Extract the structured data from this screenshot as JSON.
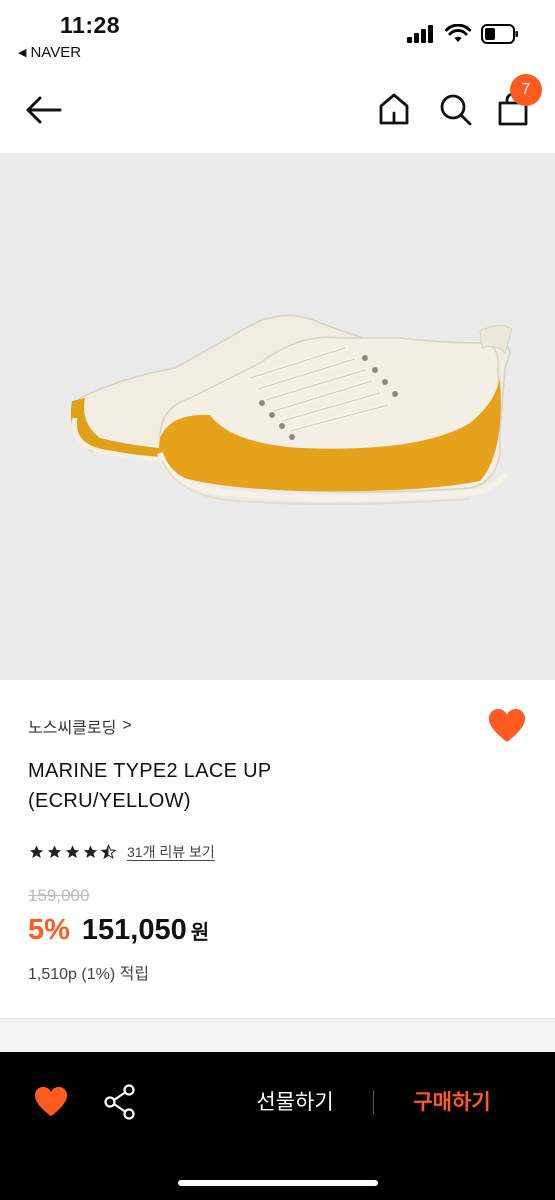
{
  "status_bar": {
    "time": "11:28",
    "back_app": "NAVER"
  },
  "header": {
    "cart_count": "7",
    "icons": [
      "back-arrow-icon",
      "home-icon",
      "search-icon",
      "cart-icon"
    ]
  },
  "product": {
    "brand": "노스씨클로딩",
    "brand_chevron": ">",
    "name_line1": "MARINE TYPE2 LACE UP",
    "name_line2": "(ECRU/YELLOW)",
    "rating_stars": 4.5,
    "review_link": "31개 리뷰 보기",
    "original_price": "159,000",
    "discount": "5%",
    "sale_price": "151,050",
    "currency": "원",
    "points": "1,510p (1%) 적립"
  },
  "bottom_bar": {
    "gift_label": "선물하기",
    "buy_label": "구매하기"
  },
  "colors": {
    "accent": "#ff5a1f",
    "image_bg": "#ebebeb",
    "bottom_bar_bg": "#000000"
  }
}
